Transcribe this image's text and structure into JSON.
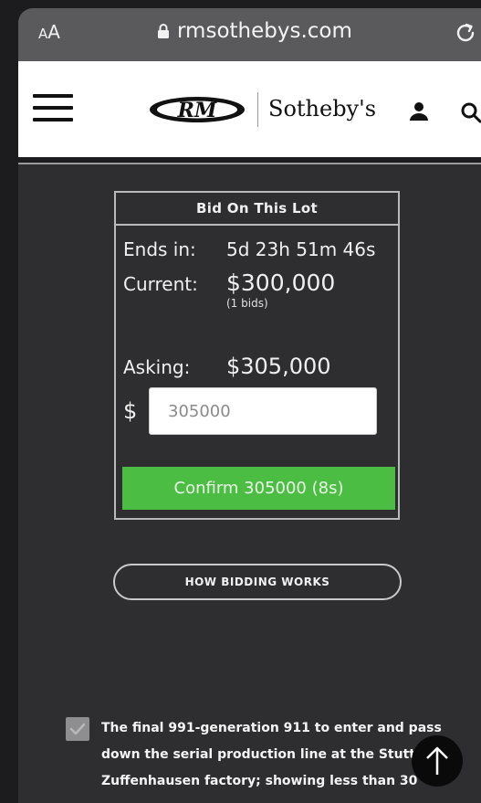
{
  "browser": {
    "aa_small": "A",
    "aa_big": "A",
    "url": "rmsothebys.com"
  },
  "header": {
    "logo_rm": "RM",
    "logo_sothebys": "Sotheby's"
  },
  "bid_panel": {
    "title": "Bid On This Lot",
    "ends_label": "Ends in:",
    "ends_value": "5d 23h 51m 46s",
    "current_label": "Current:",
    "current_value": "$300,000",
    "bids_count": "(1 bids)",
    "asking_label": "Asking:",
    "asking_value": "$305,000",
    "currency_symbol": "$",
    "bid_input_value": "305000",
    "confirm_label": "Confirm 305000 (8s)"
  },
  "how_bidding": {
    "label": "HOW BIDDING WORKS"
  },
  "description": {
    "lines": [
      "The final 991-generation 911 to enter and pass",
      "down the serial production line at the Stutt",
      "Zuffenhausen factory; showing less than 30"
    ]
  },
  "colors": {
    "confirm_green": "#4bbd43",
    "panel_bg": "#2e2e30",
    "address_bar": "#5a5a5c"
  }
}
